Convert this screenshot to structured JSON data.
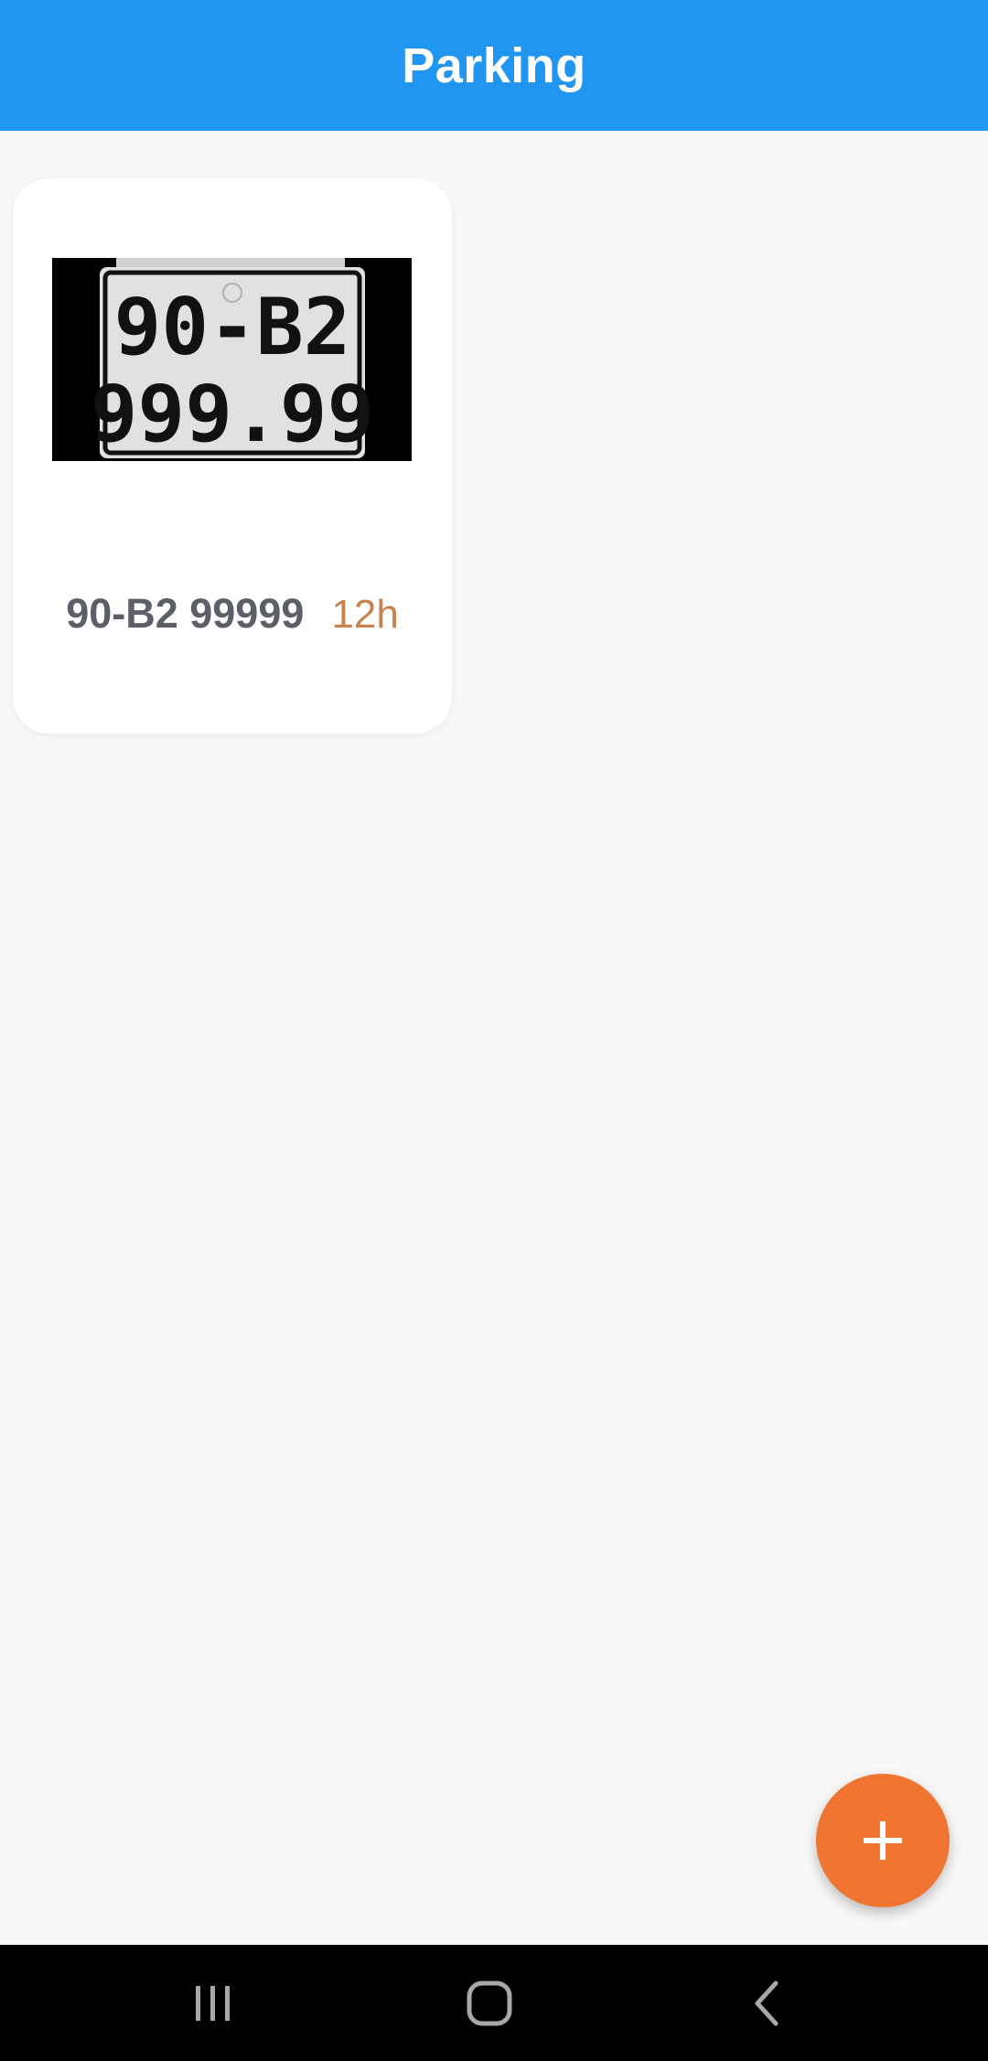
{
  "app_bar": {
    "title": "Parking",
    "color": "#2196f1"
  },
  "parking_list": [
    {
      "plate_image_text": [
        "90-B2",
        "999.99"
      ],
      "plate_number": "90-B2 99999",
      "duration": "12h"
    }
  ],
  "fab": {
    "icon": "plus-icon",
    "color": "#f07532"
  },
  "system_nav": {
    "recents_icon": "recents-icon",
    "home_icon": "home-icon",
    "back_icon": "back-icon"
  }
}
